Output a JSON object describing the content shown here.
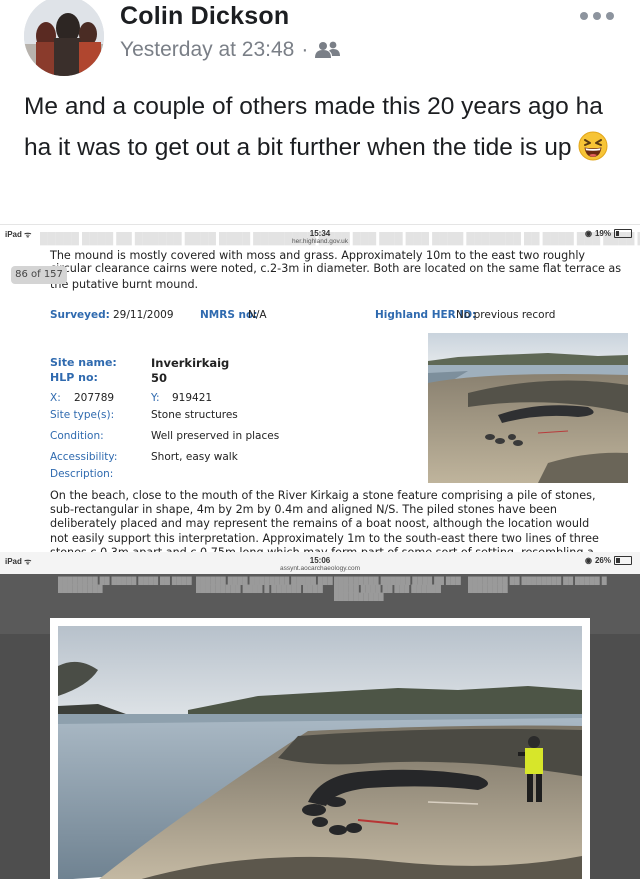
{
  "post": {
    "author": "Colin Dickson",
    "timestamp": "Yesterday at 23:48",
    "separator": "·",
    "privacy_icon": "friends-icon",
    "more_icon": "more-options-icon",
    "text": "Me and a couple of others made this 20 years ago ha ha it was to get out a bit further when the tide is up",
    "emoji": "grinning-squinting-face"
  },
  "screenshot1": {
    "status": {
      "device": "iPad ᯤ",
      "time": "15:34",
      "url": "her.highland.gov.uk",
      "battery": "19%",
      "battery_level": 0.19
    },
    "page_badge": "86 of 157",
    "clipped_lines": [
      "The mound is mostly covered with moss and grass. Approximately 10m to the east two roughly",
      "circular clearance cairns were noted, c.2-3m in diameter. Both are located on the same flat terrace as",
      "the putative burnt mound."
    ],
    "record": {
      "surveyed_label": "Surveyed:",
      "surveyed_value": "29/11/2009",
      "nmrs_label": "NMRS no:",
      "nmrs_value": "N/A",
      "her_label": "Highland HER ID:",
      "her_value": "No previous record",
      "site_name_label": "Site name:",
      "site_name_value": "Inverkirkaig",
      "hlp_label": "HLP no:",
      "hlp_value": "50",
      "x_label": "X:",
      "x_value": "207789",
      "y_label": "Y:",
      "y_value": "919421",
      "type_label": "Site type(s):",
      "type_value": "Stone structures",
      "condition_label": "Condition:",
      "condition_value": "Well preserved in places",
      "access_label": "Accessibility:",
      "access_value": "Short, easy walk",
      "description_label": "Description:",
      "description": "On the beach, close to the mouth of the River Kirkaig a stone feature comprising a pile of stones, sub-rectangular in shape, 4m by 2m by 0.4m and aligned N/S. The piled stones have been deliberately placed and may represent the remains of a boat noost, although the location would not easily support this interpretation. Approximately 1m to the south-east there two lines of three stones c.0.3m apart and c.0.75m long which may form part of some sort of setting, resembling a hearth. The function of these"
    }
  },
  "screenshot2": {
    "status": {
      "device": "iPad ᯤ",
      "time": "15:06",
      "url": "assynt.aocarchaeology.com",
      "battery": "26%",
      "battery_level": 0.26
    }
  }
}
